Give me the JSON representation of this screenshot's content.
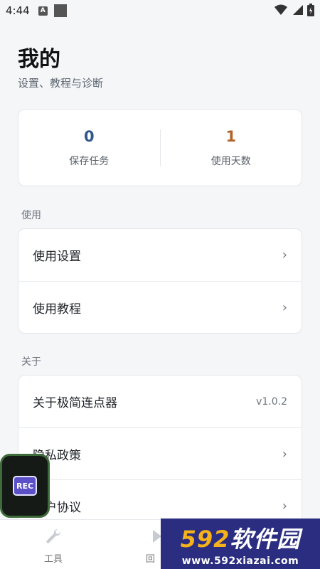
{
  "status_bar": {
    "time": "4:44",
    "notif_icon_letter": "A"
  },
  "header": {
    "title": "我的",
    "subtitle": "设置、教程与诊断"
  },
  "stats": {
    "saved_tasks": {
      "value": "0",
      "label": "保存任务"
    },
    "usage_days": {
      "value": "1",
      "label": "使用天数"
    }
  },
  "sections": {
    "usage": {
      "title": "使用",
      "items": [
        {
          "label": "使用设置",
          "chevron": "›"
        },
        {
          "label": "使用教程",
          "chevron": "›"
        }
      ]
    },
    "about": {
      "title": "关于",
      "items": [
        {
          "label": "关于极简连点器",
          "version": "v1.0.2"
        },
        {
          "label": "隐私政策",
          "chevron": "›"
        },
        {
          "label": "用户协议",
          "chevron": "›"
        }
      ]
    }
  },
  "bottom_nav": {
    "tool_label": "工具",
    "playback_label_partial": "回"
  },
  "floating": {
    "rec_label": "REC"
  },
  "watermark": {
    "num": "592",
    "text": "软件园",
    "url": "www.592xiazai.com"
  },
  "colors": {
    "stat_blue": "#2f568f",
    "stat_orange": "#b3622a",
    "watermark_bg": "#2b2d80",
    "watermark_num": "#f5b21b"
  }
}
